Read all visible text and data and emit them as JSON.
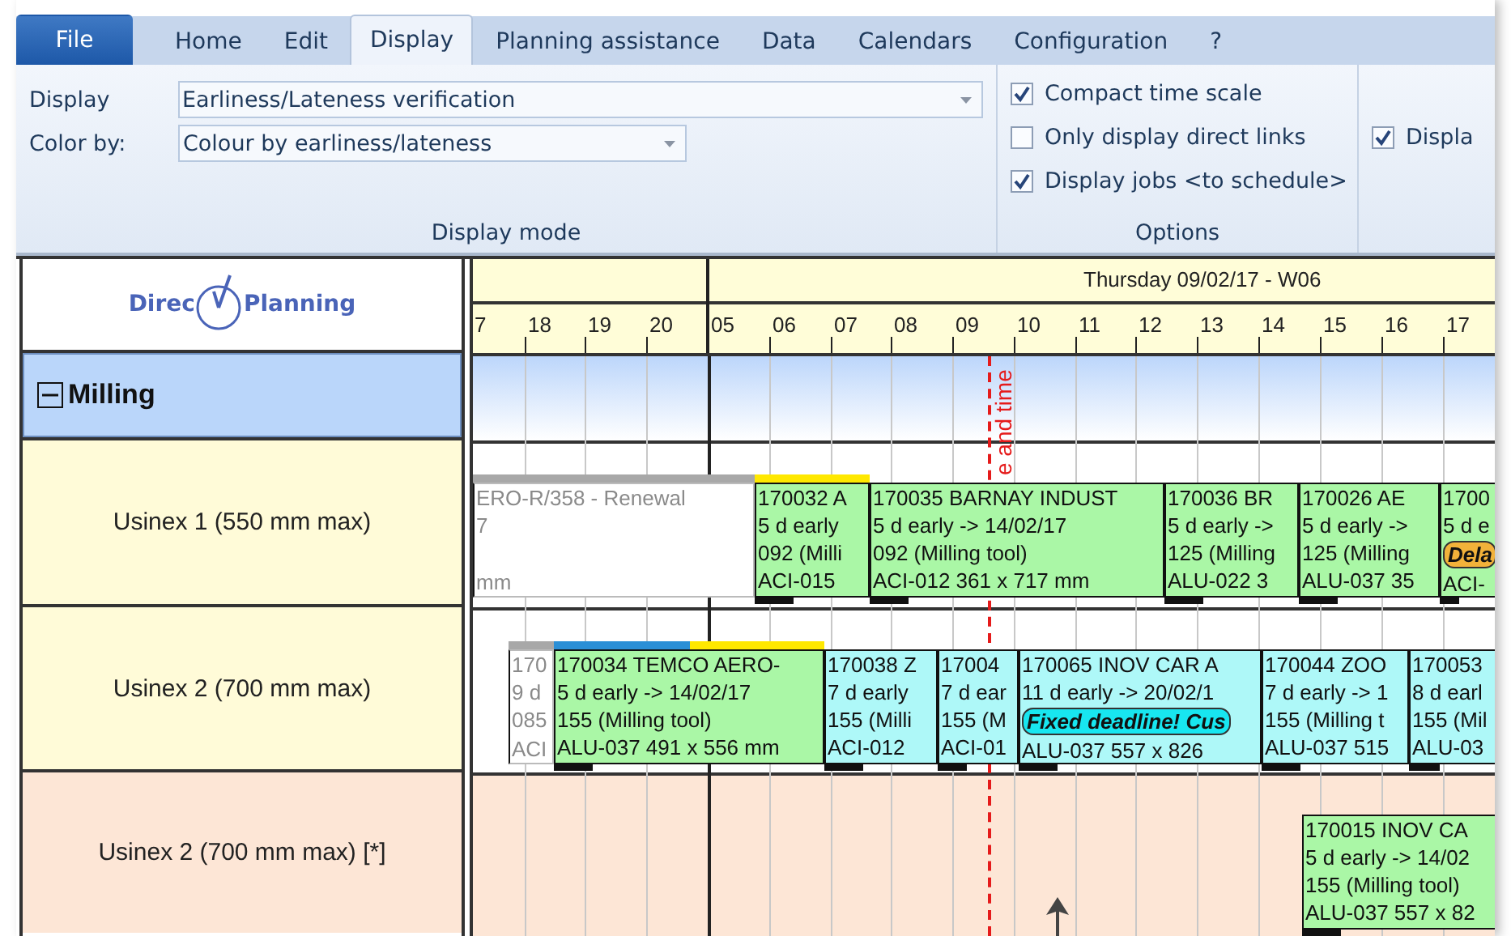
{
  "ribbon": {
    "tabs": [
      {
        "label": "File",
        "kind": "file",
        "selected": false
      },
      {
        "label": "Home",
        "kind": "tab",
        "selected": false
      },
      {
        "label": "Edit",
        "kind": "tab",
        "selected": false
      },
      {
        "label": "Display",
        "kind": "tab",
        "selected": true
      },
      {
        "label": "Planning assistance",
        "kind": "tab",
        "selected": false
      },
      {
        "label": "Data",
        "kind": "tab",
        "selected": false
      },
      {
        "label": "Calendars",
        "kind": "tab",
        "selected": false
      },
      {
        "label": "Configuration",
        "kind": "tab",
        "selected": false
      },
      {
        "label": "?",
        "kind": "tab",
        "selected": false
      }
    ],
    "display_mode": {
      "title": "Display mode",
      "fields": [
        {
          "label": "Display",
          "value": "Earliness/Lateness verification"
        },
        {
          "label": "Color by:",
          "value": "Colour by earliness/lateness"
        }
      ]
    },
    "options": {
      "title": "Options",
      "checkboxes": [
        {
          "label": "Compact time scale",
          "checked": true
        },
        {
          "label": "Only display direct links",
          "checked": false
        },
        {
          "label": "Display jobs <to schedule>",
          "checked": true
        }
      ]
    },
    "group_3": {
      "checkboxes": [
        {
          "label": "Displa",
          "checked": true
        }
      ]
    }
  },
  "gantt": {
    "logo": {
      "text_before": "Direc",
      "text_after": "Planning"
    },
    "timescale": {
      "day": "Thursday 09/02/17 - W06",
      "hours": [
        "7",
        "18",
        "19",
        "20",
        "05",
        "06",
        "07",
        "08",
        "09",
        "10",
        "11",
        "12",
        "13",
        "14",
        "15",
        "16",
        "17"
      ]
    },
    "current_time_label": "e and time",
    "group": {
      "name": "Milling",
      "expanded": true,
      "resources": [
        {
          "name": "Usinex 1 (550 mm max)",
          "kind": "machine",
          "color": "#fffbd8",
          "jobs": [
            {
              "kind": "ghost",
              "color": "#ffffff",
              "strips": [
                {
                  "color": "#a8a8a8"
                }
              ],
              "lines": [
                "ERO-R/358 - Renewal",
                "7",
                "mm"
              ]
            },
            {
              "kind": "job",
              "color": "#aaf7a6",
              "strips": [
                {
                  "color": "#ffe800"
                }
              ],
              "lines": [
                "170032 A",
                "5 d early",
                "092 (Milli",
                "ACI-015"
              ]
            },
            {
              "kind": "job",
              "color": "#aaf7a6",
              "lines": [
                "170035 BARNAY INDUST",
                "5 d early -> 14/02/17",
                "092 (Milling tool)",
                "ACI-012 361 x 717 mm"
              ]
            },
            {
              "kind": "job",
              "color": "#aaf7a6",
              "lines": [
                "170036 BR",
                "5 d early ->",
                "125 (Milling",
                "ALU-022 3"
              ]
            },
            {
              "kind": "job",
              "color": "#aaf7a6",
              "lines": [
                "170026 AE",
                "5 d early ->",
                "125 (Milling",
                "ALU-037 35"
              ]
            },
            {
              "kind": "job",
              "color": "#aaf7a6",
              "lines": [
                "1700",
                "5 d e",
                "ACI-"
              ],
              "badge": {
                "text": "Dela",
                "color": "#f2b23a"
              }
            }
          ]
        },
        {
          "name": "Usinex 2 (700 mm max)",
          "kind": "machine",
          "color": "#fffbd8",
          "jobs": [
            {
              "kind": "ghost",
              "color": "#ffffff",
              "strips": [
                {
                  "color": "#a8a8a8"
                }
              ],
              "lines": [
                "170",
                "9 d",
                "085",
                "ACI"
              ]
            },
            {
              "kind": "job",
              "color": "#aaf7a6",
              "strips": [
                {
                  "color": "#2a8fd6"
                },
                {
                  "color": "#ffe800"
                }
              ],
              "lines": [
                "170034 TEMCO AERO-",
                "5 d early -> 14/02/17",
                "155 (Milling tool)",
                "ALU-037 491 x 556 mm"
              ]
            },
            {
              "kind": "job",
              "color": "#aef8f8",
              "lines": [
                "170038 Z",
                "7 d early",
                "155 (Milli",
                "ACI-012"
              ]
            },
            {
              "kind": "job",
              "color": "#aef8f8",
              "lines": [
                "17004",
                "7 d ear",
                "155 (M",
                "ACI-01"
              ]
            },
            {
              "kind": "job",
              "color": "#aef8f8",
              "lines": [
                "170065 INOV CAR A",
                "11 d early -> 20/02/1",
                "ALU-037 557 x 826"
              ],
              "badge": {
                "text": "Fixed deadline! Cus",
                "color": "#18e6f0"
              }
            },
            {
              "kind": "job",
              "color": "#aef8f8",
              "lines": [
                "170044 ZOO",
                "7 d early -> 1",
                "155 (Milling t",
                "ALU-037 515"
              ]
            },
            {
              "kind": "job",
              "color": "#aef8f8",
              "lines": [
                "170053",
                "8 d earl",
                "155 (Mil",
                "ALU-03"
              ]
            }
          ]
        },
        {
          "name": "Usinex 2 (700 mm max) [*]",
          "kind": "copy",
          "color": "#fde6d6",
          "jobs": [
            {
              "kind": "job",
              "color": "#aaf7a6",
              "lines": [
                "170015 INOV CA",
                "5 d early -> 14/02",
                "155 (Milling tool)",
                "ALU-037 557 x 82"
              ]
            }
          ]
        }
      ]
    }
  }
}
